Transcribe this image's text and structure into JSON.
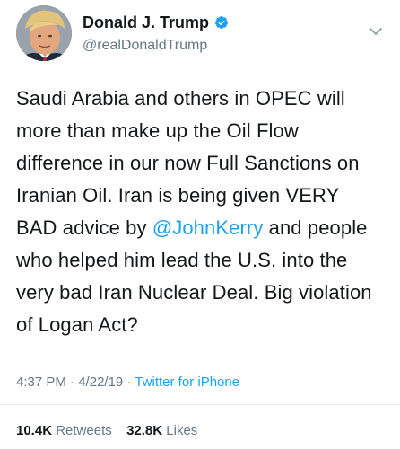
{
  "user": {
    "display_name": "Donald J. Trump",
    "handle": "@realDonaldTrump",
    "verified": true
  },
  "tweet": {
    "text_before_mention": "Saudi Arabia and others in OPEC will more than make up the Oil Flow difference in our now Full Sanctions on Iranian Oil. Iran is being given VERY BAD advice by ",
    "mention": "@JohnKerry",
    "text_after_mention": " and people who helped him lead the U.S. into the very bad Iran Nuclear Deal. Big violation of Logan Act?"
  },
  "meta": {
    "time": "4:37 PM",
    "date": "4/22/19",
    "separator": "·",
    "source": "Twitter for iPhone"
  },
  "stats": {
    "retweets_count": "10.4K",
    "retweets_label": "Retweets",
    "likes_count": "32.8K",
    "likes_label": "Likes"
  },
  "colors": {
    "link": "#1da1f2",
    "secondary_text": "#657786",
    "primary_text": "#14171a",
    "divider": "#e6ecf0"
  },
  "icons": {
    "verified": "verified-badge-icon",
    "caret": "chevron-down-icon"
  }
}
